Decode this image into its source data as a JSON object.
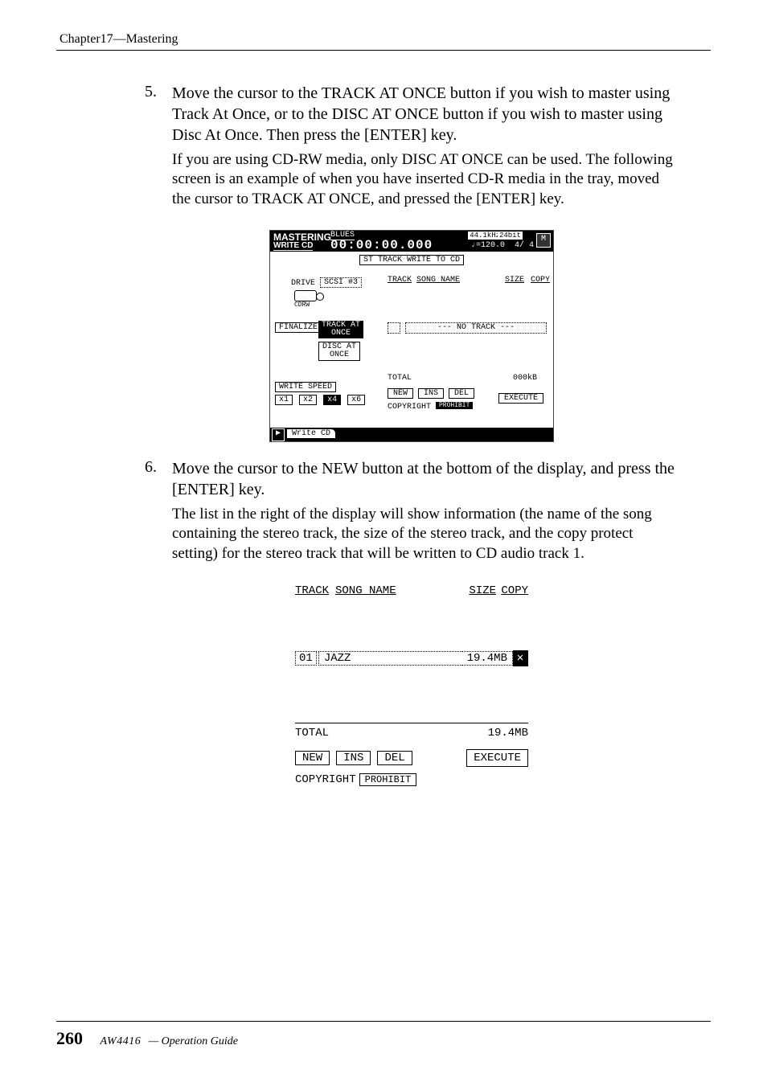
{
  "header": {
    "breadcrumb": "Chapter17—Mastering"
  },
  "step5": {
    "number": "5.",
    "lead": "Move the cursor to the TRACK AT ONCE button if you wish to master using Track At Once, or to the DISC AT ONCE button if you wish to master using Disc At Once. Then press the [ENTER] key.",
    "para": "If you are using CD-RW media, only DISC AT ONCE can be used. The following screen is an example of when you have inserted CD-R media in the tray, moved the cursor to TRACK AT ONCE, and pressed the [ENTER] key."
  },
  "screen1": {
    "mastering": "MASTERING",
    "writecd": "WRITE CD",
    "songname": "BLUES",
    "timecode": "00:00:00.000",
    "rate": "44.1kHz",
    "bit": "24bit",
    "tempo": "♩=120.0",
    "timesig": "4/ 4",
    "m_icon": "M",
    "subtitle": "ST TRACK WRITE TO CD",
    "drive_label": "DRIVE",
    "drive_value": "SCSI #3",
    "cdrw_label": "CDRW",
    "finalize": "FINALIZE",
    "track_at_once": "TRACK AT\nONCE",
    "disc_at_once": "DISC AT\nONCE",
    "th_track": "TRACK",
    "th_song": "SONG NAME",
    "th_size": "SIZE",
    "th_copy": "COPY",
    "no_track": "--- NO TRACK ---",
    "total_label": "TOTAL",
    "total_value": "000kB",
    "write_speed_label": "WRITE SPEED",
    "speeds": {
      "x1": "x1",
      "x2": "x2",
      "x4": "x4",
      "x6": "x6"
    },
    "new": "NEW",
    "ins": "INS",
    "del": "DEL",
    "execute": "EXECUTE",
    "copyright_label": "COPYRIGHT",
    "copyright_value": "PROHIBIT",
    "tab_icon": "▶",
    "tab_writecd": "Write CD"
  },
  "step6": {
    "number": "6.",
    "lead": "Move the cursor to the NEW button at the bottom of the display, and press the [ENTER] key.",
    "para": "The list in the right of the display will show information (the name of the song containing the stereo track, the size of the stereo track, and the copy protect setting) for the stereo track that will be written to CD audio track 1."
  },
  "screen2": {
    "th_track": "TRACK",
    "th_song": "SONG NAME",
    "th_size": "SIZE",
    "th_copy": "COPY",
    "row_trk": "01",
    "row_song": "JAZZ",
    "row_size": "19.4MB",
    "row_copy": "✕",
    "total_label": "TOTAL",
    "total_value": "19.4MB",
    "new": "NEW",
    "ins": "INS",
    "del": "DEL",
    "execute": "EXECUTE",
    "copyright_label": "COPYRIGHT",
    "copyright_value": "PROHIBIT"
  },
  "footer": {
    "page": "260",
    "model": "AW4416",
    "guide": "— Operation Guide"
  }
}
